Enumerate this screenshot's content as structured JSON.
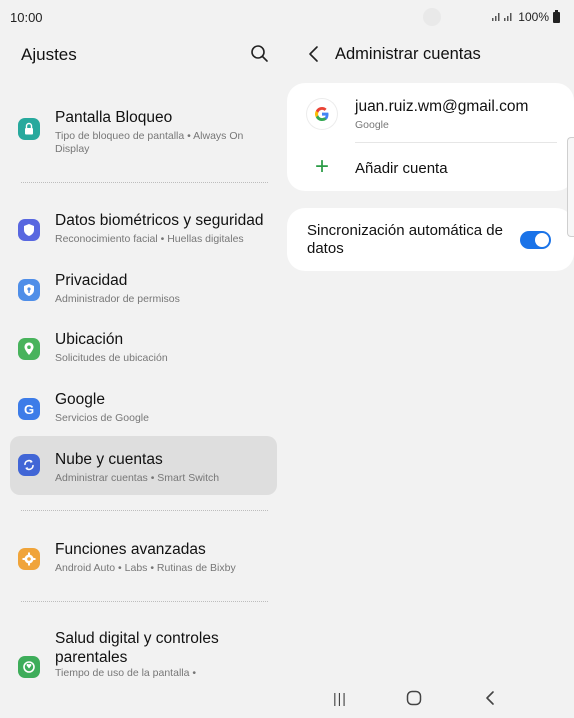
{
  "status_bar": {
    "time": "10:00",
    "battery": "100%",
    "icons": [
      "camera-cutout",
      "signal-icon",
      "battery-icon"
    ]
  },
  "left_panel": {
    "title": "Ajustes",
    "search_icon": "search-icon",
    "items": [
      {
        "title": "Pantalla Bloqueo",
        "subtitle": "Tipo de bloqueo de pantalla  •  Always On Display",
        "icon": "lock-icon",
        "icon_color": "#27a99d"
      },
      {
        "title": "Datos biométricos y seguridad",
        "subtitle": "Reconocimiento facial  •  Huellas digitales",
        "icon": "shield-icon",
        "icon_color": "#5867e0"
      },
      {
        "title": "Privacidad",
        "subtitle": "Administrador de permisos",
        "icon": "privacy-shield-icon",
        "icon_color": "#4f8ee8"
      },
      {
        "title": "Ubicación",
        "subtitle": "Solicitudes de ubicación",
        "icon": "location-icon",
        "icon_color": "#48b35c"
      },
      {
        "title": "Google",
        "subtitle": "Servicios de Google",
        "icon": "google-icon",
        "icon_color": "#3d7ce8"
      },
      {
        "title": "Nube y cuentas",
        "subtitle": "Administrar cuentas  •  Smart Switch",
        "icon": "sync-icon",
        "icon_color": "#4166d6"
      },
      {
        "title": "Funciones avanzadas",
        "subtitle": "Android Auto  •  Labs  •  Rutinas de Bixby",
        "icon": "advanced-features-icon",
        "icon_color": "#f0a43a"
      },
      {
        "title": "Salud digital y controles parentales",
        "subtitle": "Tiempo de uso de la pantalla  •",
        "icon": "digital-wellbeing-icon",
        "icon_color": "#3ead5a"
      }
    ]
  },
  "right_panel": {
    "title": "Administrar cuentas",
    "back_icon": "back-chevron-icon",
    "account": {
      "avatar_letter": "G",
      "email": "juan.ruiz.wm@gmail.com",
      "type": "Google"
    },
    "add_account": {
      "icon_glyph": "+",
      "label": "Añadir cuenta"
    },
    "sync": {
      "label": "Sincronización automática de datos",
      "enabled": true,
      "accent": "#1a73e8"
    }
  },
  "nav_bar": {
    "recent_glyph": "|||",
    "buttons": [
      "recent-apps-icon",
      "home-icon",
      "back-icon"
    ]
  }
}
